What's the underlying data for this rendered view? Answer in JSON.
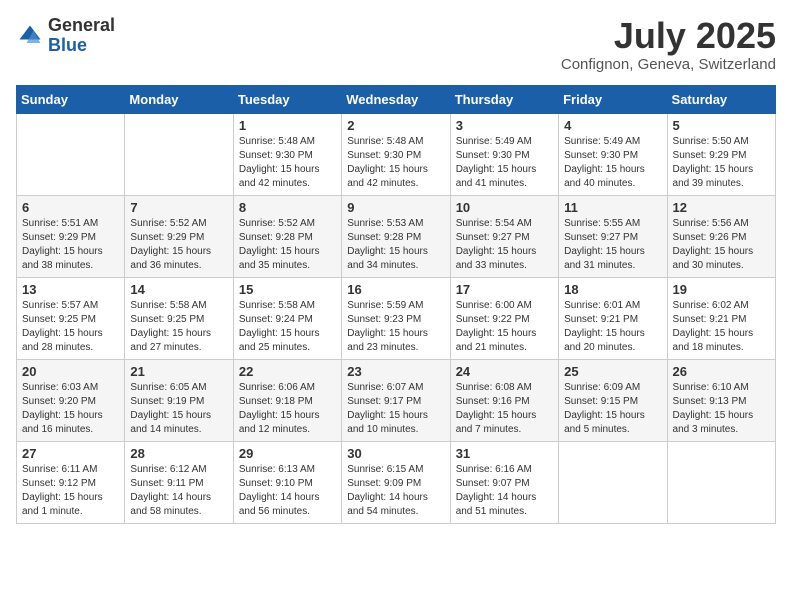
{
  "logo": {
    "general": "General",
    "blue": "Blue"
  },
  "title": "July 2025",
  "subtitle": "Confignon, Geneva, Switzerland",
  "days_of_week": [
    "Sunday",
    "Monday",
    "Tuesday",
    "Wednesday",
    "Thursday",
    "Friday",
    "Saturday"
  ],
  "weeks": [
    [
      {
        "day": "",
        "info": ""
      },
      {
        "day": "",
        "info": ""
      },
      {
        "day": "1",
        "info": "Sunrise: 5:48 AM\nSunset: 9:30 PM\nDaylight: 15 hours and 42 minutes."
      },
      {
        "day": "2",
        "info": "Sunrise: 5:48 AM\nSunset: 9:30 PM\nDaylight: 15 hours and 42 minutes."
      },
      {
        "day": "3",
        "info": "Sunrise: 5:49 AM\nSunset: 9:30 PM\nDaylight: 15 hours and 41 minutes."
      },
      {
        "day": "4",
        "info": "Sunrise: 5:49 AM\nSunset: 9:30 PM\nDaylight: 15 hours and 40 minutes."
      },
      {
        "day": "5",
        "info": "Sunrise: 5:50 AM\nSunset: 9:29 PM\nDaylight: 15 hours and 39 minutes."
      }
    ],
    [
      {
        "day": "6",
        "info": "Sunrise: 5:51 AM\nSunset: 9:29 PM\nDaylight: 15 hours and 38 minutes."
      },
      {
        "day": "7",
        "info": "Sunrise: 5:52 AM\nSunset: 9:29 PM\nDaylight: 15 hours and 36 minutes."
      },
      {
        "day": "8",
        "info": "Sunrise: 5:52 AM\nSunset: 9:28 PM\nDaylight: 15 hours and 35 minutes."
      },
      {
        "day": "9",
        "info": "Sunrise: 5:53 AM\nSunset: 9:28 PM\nDaylight: 15 hours and 34 minutes."
      },
      {
        "day": "10",
        "info": "Sunrise: 5:54 AM\nSunset: 9:27 PM\nDaylight: 15 hours and 33 minutes."
      },
      {
        "day": "11",
        "info": "Sunrise: 5:55 AM\nSunset: 9:27 PM\nDaylight: 15 hours and 31 minutes."
      },
      {
        "day": "12",
        "info": "Sunrise: 5:56 AM\nSunset: 9:26 PM\nDaylight: 15 hours and 30 minutes."
      }
    ],
    [
      {
        "day": "13",
        "info": "Sunrise: 5:57 AM\nSunset: 9:25 PM\nDaylight: 15 hours and 28 minutes."
      },
      {
        "day": "14",
        "info": "Sunrise: 5:58 AM\nSunset: 9:25 PM\nDaylight: 15 hours and 27 minutes."
      },
      {
        "day": "15",
        "info": "Sunrise: 5:58 AM\nSunset: 9:24 PM\nDaylight: 15 hours and 25 minutes."
      },
      {
        "day": "16",
        "info": "Sunrise: 5:59 AM\nSunset: 9:23 PM\nDaylight: 15 hours and 23 minutes."
      },
      {
        "day": "17",
        "info": "Sunrise: 6:00 AM\nSunset: 9:22 PM\nDaylight: 15 hours and 21 minutes."
      },
      {
        "day": "18",
        "info": "Sunrise: 6:01 AM\nSunset: 9:21 PM\nDaylight: 15 hours and 20 minutes."
      },
      {
        "day": "19",
        "info": "Sunrise: 6:02 AM\nSunset: 9:21 PM\nDaylight: 15 hours and 18 minutes."
      }
    ],
    [
      {
        "day": "20",
        "info": "Sunrise: 6:03 AM\nSunset: 9:20 PM\nDaylight: 15 hours and 16 minutes."
      },
      {
        "day": "21",
        "info": "Sunrise: 6:05 AM\nSunset: 9:19 PM\nDaylight: 15 hours and 14 minutes."
      },
      {
        "day": "22",
        "info": "Sunrise: 6:06 AM\nSunset: 9:18 PM\nDaylight: 15 hours and 12 minutes."
      },
      {
        "day": "23",
        "info": "Sunrise: 6:07 AM\nSunset: 9:17 PM\nDaylight: 15 hours and 10 minutes."
      },
      {
        "day": "24",
        "info": "Sunrise: 6:08 AM\nSunset: 9:16 PM\nDaylight: 15 hours and 7 minutes."
      },
      {
        "day": "25",
        "info": "Sunrise: 6:09 AM\nSunset: 9:15 PM\nDaylight: 15 hours and 5 minutes."
      },
      {
        "day": "26",
        "info": "Sunrise: 6:10 AM\nSunset: 9:13 PM\nDaylight: 15 hours and 3 minutes."
      }
    ],
    [
      {
        "day": "27",
        "info": "Sunrise: 6:11 AM\nSunset: 9:12 PM\nDaylight: 15 hours and 1 minute."
      },
      {
        "day": "28",
        "info": "Sunrise: 6:12 AM\nSunset: 9:11 PM\nDaylight: 14 hours and 58 minutes."
      },
      {
        "day": "29",
        "info": "Sunrise: 6:13 AM\nSunset: 9:10 PM\nDaylight: 14 hours and 56 minutes."
      },
      {
        "day": "30",
        "info": "Sunrise: 6:15 AM\nSunset: 9:09 PM\nDaylight: 14 hours and 54 minutes."
      },
      {
        "day": "31",
        "info": "Sunrise: 6:16 AM\nSunset: 9:07 PM\nDaylight: 14 hours and 51 minutes."
      },
      {
        "day": "",
        "info": ""
      },
      {
        "day": "",
        "info": ""
      }
    ]
  ]
}
